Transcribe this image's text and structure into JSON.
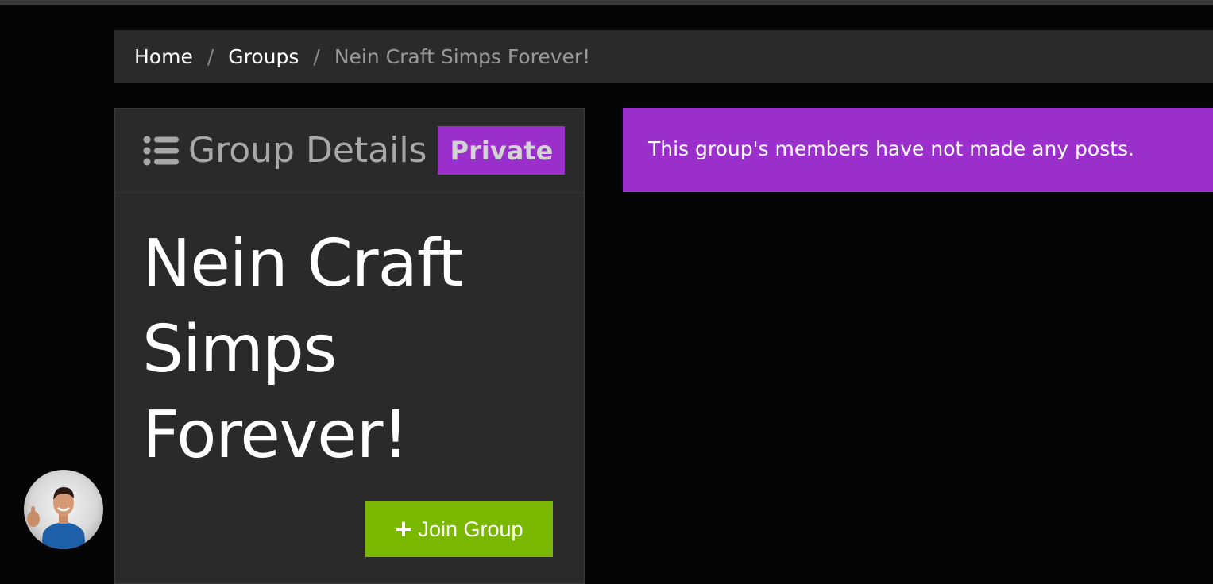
{
  "breadcrumb": {
    "home": "Home",
    "sep1": "/",
    "groups": "Groups",
    "sep2": "/",
    "current": "Nein Craft Simps Forever!"
  },
  "card": {
    "header_icon": "list-icon",
    "title": "Group Details",
    "badge": "Private",
    "group_name": "Nein Craft Simps Forever!",
    "join_icon": "plus-icon",
    "join_label": "Join Group"
  },
  "alert": {
    "message": "This group's members have not made any posts."
  },
  "avatar": {
    "icon": "user-avatar"
  },
  "colors": {
    "background": "#050505",
    "panel": "#2a2a2a",
    "accent_purple": "#9b2fcc",
    "join_green": "#7ab800"
  }
}
